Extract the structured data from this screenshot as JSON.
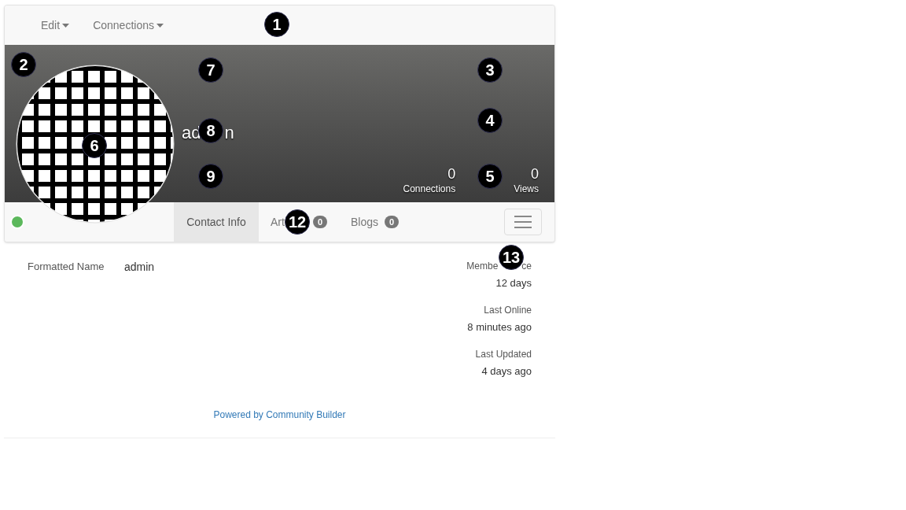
{
  "navbar": {
    "menus": [
      {
        "label": "Edit"
      },
      {
        "label": "Connections"
      }
    ]
  },
  "cover": {
    "name_parts": [
      "ad",
      "n"
    ],
    "stats": [
      {
        "value": "0",
        "label": "Connections"
      },
      {
        "value": "0",
        "label": "Views"
      }
    ]
  },
  "status": {
    "online": true
  },
  "tabs": [
    {
      "label": "Contact Info",
      "selected": true
    },
    {
      "label": "Art",
      "count": "0",
      "selected": false
    },
    {
      "label": "Blogs",
      "count": "0",
      "selected": false
    }
  ],
  "fields": [
    {
      "label": "Formatted Name",
      "value": "admin"
    }
  ],
  "side_info": [
    {
      "label_parts": [
        "Membe",
        "ce"
      ],
      "value": "12 days"
    },
    {
      "label_parts": [
        "Last Online"
      ],
      "value": "8 minutes ago"
    },
    {
      "label_parts": [
        "Last Updated"
      ],
      "value": "4 days ago"
    }
  ],
  "footer": {
    "link": "Powered by Community Builder"
  },
  "markers": [
    "1",
    "2",
    "3",
    "4",
    "5",
    "6",
    "7",
    "8",
    "9",
    "12",
    "13"
  ]
}
